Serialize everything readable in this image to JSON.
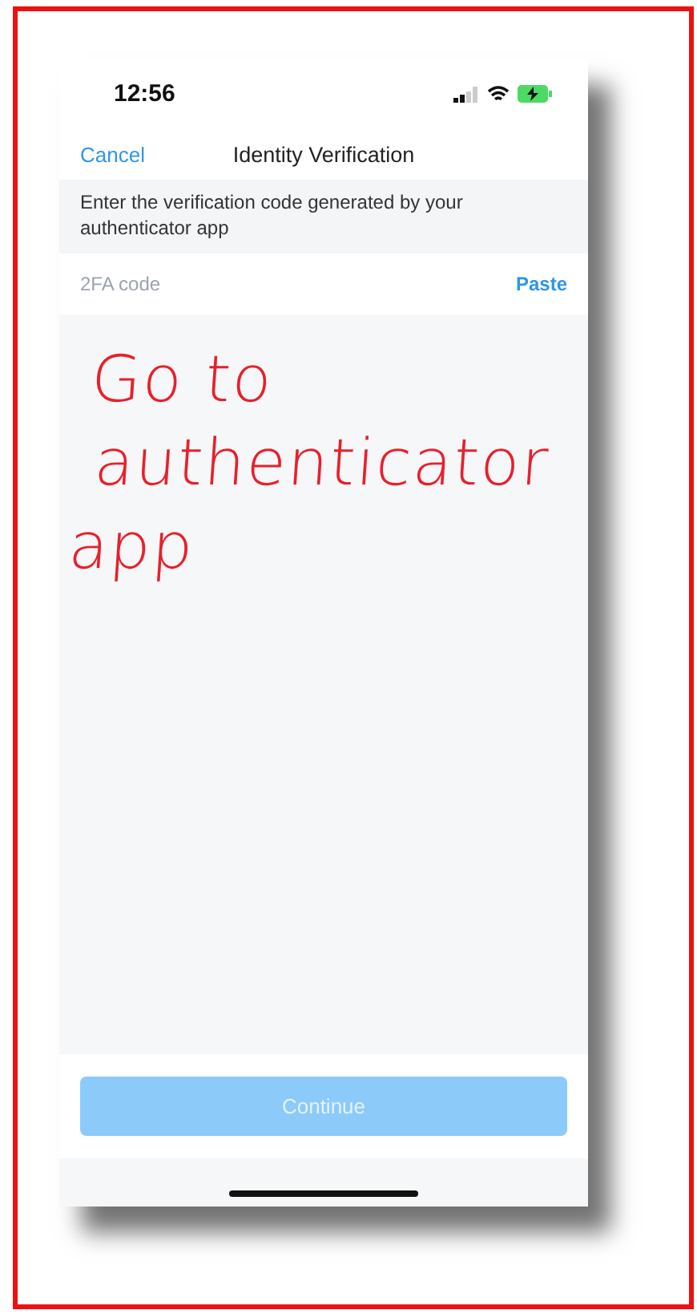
{
  "status_bar": {
    "time": "12:56"
  },
  "nav_bar": {
    "cancel": "Cancel",
    "title": "Identity Verification"
  },
  "instructions": "Enter the verification code generated by your authenticator app",
  "code_field": {
    "placeholder": "2FA code",
    "paste": "Paste"
  },
  "annotation": [
    "Go to",
    "authenticator",
    "app"
  ],
  "continue_button": {
    "label": "Continue",
    "disabled": true
  }
}
